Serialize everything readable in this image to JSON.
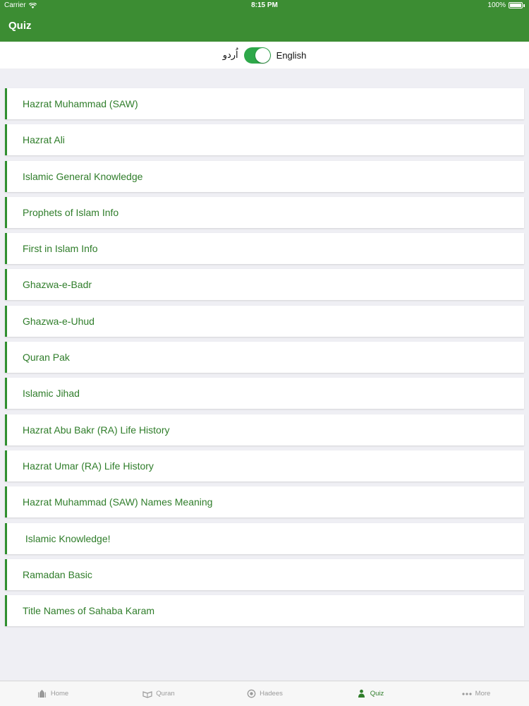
{
  "status_bar": {
    "carrier": "Carrier",
    "time": "8:15 PM",
    "battery": "100%"
  },
  "nav": {
    "title": "Quiz"
  },
  "language": {
    "urdu_label": "اُردو",
    "english_label": "English",
    "toggle_on": true
  },
  "quiz_items": [
    "Hazrat Muhammad (SAW)",
    "Hazrat Ali",
    "Islamic General Knowledge",
    "Prophets of Islam Info",
    "First in Islam Info",
    "Ghazwa-e-Badr",
    "Ghazwa-e-Uhud",
    "Quran Pak",
    "Islamic Jihad",
    "Hazrat Abu Bakr (RA) Life History",
    "Hazrat Umar (RA) Life History",
    "Hazrat Muhammad (SAW) Names Meaning",
    " Islamic Knowledge!",
    "Ramadan Basic",
    "Title Names of Sahaba Karam"
  ],
  "tabs": [
    {
      "label": "Home",
      "icon": "mosque-icon"
    },
    {
      "label": "Quran",
      "icon": "quran-icon"
    },
    {
      "label": "Hadees",
      "icon": "hadees-icon"
    },
    {
      "label": "Quiz",
      "icon": "quiz-icon",
      "active": true
    },
    {
      "label": "More",
      "icon": "more-icon"
    }
  ],
  "colors": {
    "primary": "#3c8d33",
    "item_text": "#2f7d2a",
    "accent_bar": "#2f8f2f",
    "toggle_on": "#2ea84a",
    "background": "#efeff4"
  }
}
